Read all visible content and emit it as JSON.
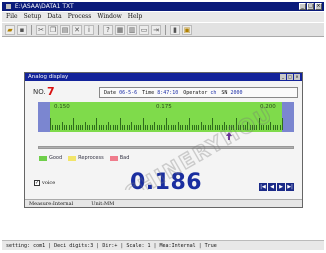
{
  "window": {
    "title": "E:\\ASAA\\DATA1 TXT"
  },
  "menu": [
    "File",
    "Setup",
    "Data",
    "Process",
    "Window",
    "Help"
  ],
  "dialog": {
    "title": "Analog display",
    "no_label": "NO.",
    "no_value": "7",
    "info": {
      "date_label": "Date",
      "date": "06-5-6",
      "time_label": "Time",
      "time": "8:47:10",
      "operator_label": "Operator",
      "operator": "ch",
      "sn_label": "SN",
      "sn": "2000"
    },
    "scale": {
      "left": "0.150",
      "center": "0.175",
      "right": "0.200"
    },
    "legend": [
      {
        "label": "Good",
        "color": "#6fcf4a"
      },
      {
        "label": "Reprocess",
        "color": "#f2e56a"
      },
      {
        "label": "Bad",
        "color": "#ef7c8c"
      }
    ],
    "voice_label": "voice",
    "reading": "0.186",
    "status": {
      "measure": "Measure:Internal",
      "unit": "Unit:MM"
    }
  },
  "watermark": "MACHINERYHOUSE",
  "statusbar": "setting: com1 | Deci digits:3 | Dir:+ | Scale: 1 | Mea:Internal | True",
  "colors": {
    "titlebar": "#0a1a7a",
    "meter_green": "#7fdb4b",
    "meter_blue": "#7b86d0",
    "reading": "#1a2ea0",
    "no_value": "#d81010"
  }
}
